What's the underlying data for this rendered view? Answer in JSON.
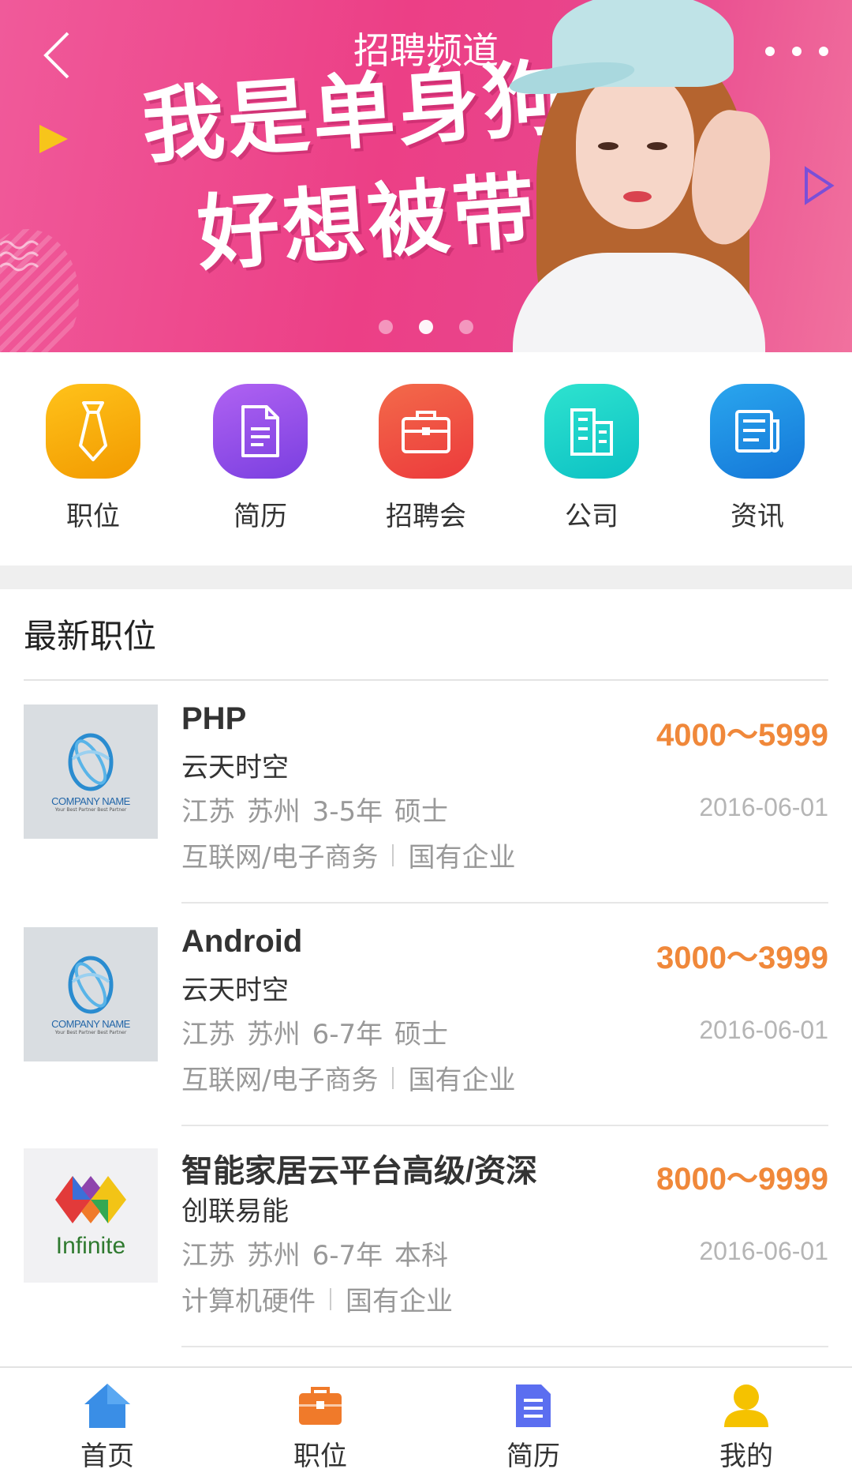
{
  "header": {
    "title": "招聘频道"
  },
  "banner": {
    "line1": "我是单身狗",
    "line2": "好想被带走"
  },
  "quick_nav": [
    {
      "label": "职位",
      "icon": "tie-icon",
      "color": "#f5a300"
    },
    {
      "label": "简历",
      "icon": "document-icon",
      "color": "#8e4ee6"
    },
    {
      "label": "招聘会",
      "icon": "briefcase-icon",
      "color": "#f0533a"
    },
    {
      "label": "公司",
      "icon": "building-icon",
      "color": "#16d2c7"
    },
    {
      "label": "资讯",
      "icon": "news-icon",
      "color": "#1f8de0"
    }
  ],
  "section": {
    "title": "最新职位"
  },
  "jobs": [
    {
      "title": "PHP",
      "company": "云天时空",
      "meta": "江苏  苏州  3-5年  硕士",
      "industry": "互联网/电子商务",
      "ownership": "国有企业",
      "salary": "4000～5999",
      "date": "2016-06-01",
      "logo": {
        "caption": "COMPANY NAME",
        "sub": "Your Best Partner Best Partner"
      }
    },
    {
      "title": "Android",
      "company": "云天时空",
      "meta": "江苏  苏州  6-7年  硕士",
      "industry": "互联网/电子商务",
      "ownership": "国有企业",
      "salary": "3000～3999",
      "date": "2016-06-01",
      "logo": {
        "caption": "COMPANY NAME",
        "sub": "Your Best Partner Best Partner"
      }
    },
    {
      "title": "智能家居云平台高级/资深",
      "company": "创联易能",
      "meta": "江苏  苏州  6-7年  本科",
      "industry": "计算机硬件",
      "ownership": "国有企业",
      "salary": "8000～9999",
      "date": "2016-06-01",
      "logo": {
        "caption": "Infinite"
      }
    }
  ],
  "tabbar": [
    {
      "label": "首页",
      "icon": "home-icon"
    },
    {
      "label": "职位",
      "icon": "briefcase-icon"
    },
    {
      "label": "简历",
      "icon": "document-icon"
    },
    {
      "label": "我的",
      "icon": "user-icon"
    }
  ],
  "colors": {
    "salary": "#f0883a",
    "banner": "#ec3f86",
    "tab_home": "#3a8ee6",
    "tab_job": "#f07a2a",
    "tab_resume": "#5b6ef0",
    "tab_me": "#f5c200"
  }
}
